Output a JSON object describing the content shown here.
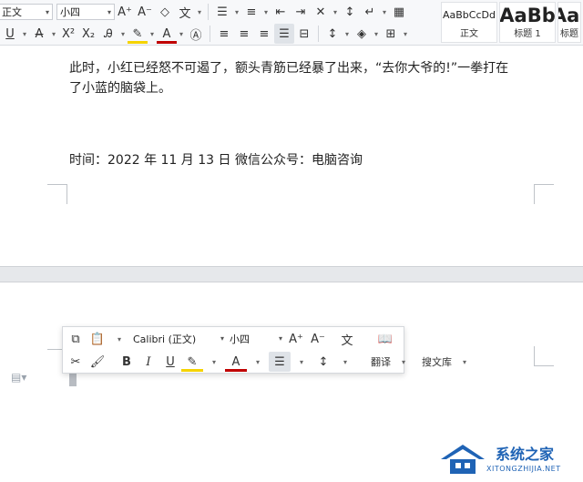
{
  "ribbon": {
    "style_select": "正文",
    "size_select": "小四",
    "styles": [
      {
        "preview": "AaBbCcDd",
        "name": "正文"
      },
      {
        "preview": "AaBb",
        "name": "标题 1"
      },
      {
        "preview": "AaI",
        "name": "标题"
      }
    ]
  },
  "document": {
    "para1_line1": "此时，小红已经怒不可遏了，额头青筋已经暴了出来，“去你大爷的!”一拳打在",
    "para1_line2": "了小蓝的脑袋上。",
    "para2": "时间：2022 年 11 月 13 日  微信公众号：电脑咨询"
  },
  "mini_toolbar": {
    "font_select": "Calibri (正文)",
    "size_select": "小四",
    "translate_label": "翻译",
    "search_doc_label": "搜文库"
  },
  "watermark": {
    "text": "系统之家",
    "sub": "XITONGZHIJIA.NET"
  },
  "colors": {
    "accent": "#1f63b5",
    "highlight": "#f5d300",
    "font_color": "#c00000"
  }
}
